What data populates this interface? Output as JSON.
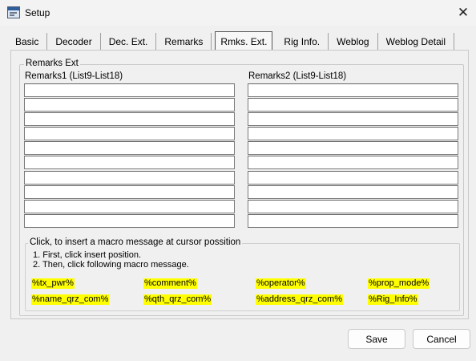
{
  "window": {
    "title": "Setup",
    "icon": "setup-app-icon"
  },
  "tabs": [
    {
      "label": "Basic"
    },
    {
      "label": "Decoder"
    },
    {
      "label": "Dec. Ext."
    },
    {
      "label": "Remarks"
    },
    {
      "label": "Rmks. Ext.",
      "active": true
    },
    {
      "label": "Rig Info."
    },
    {
      "label": "Weblog"
    },
    {
      "label": "Weblog Detail"
    }
  ],
  "remarks_ext": {
    "group_label": "Remarks Ext",
    "col1_label": "Remarks1 (List9-List18)",
    "col2_label": "Remarks2 (List9-List18)",
    "col1_values": [
      "",
      "",
      "",
      "",
      "",
      "",
      "",
      "",
      "",
      ""
    ],
    "col2_values": [
      "",
      "",
      "",
      "",
      "",
      "",
      "",
      "",
      "",
      ""
    ]
  },
  "macros": {
    "group_label": "Click, to insert a macro message at cursor possition",
    "instruction1": "1. First, click insert position.",
    "instruction2": "2. Then, click following macro message.",
    "items": [
      "%tx_pwr%",
      "%comment%",
      "%operator%",
      "%prop_mode%",
      "%name_qrz_com%",
      "%qth_qrz_com%",
      "%address_qrz_com%",
      "%Rig_Info%"
    ],
    "highlight_color": "#ffff00"
  },
  "buttons": {
    "save": "Save",
    "cancel": "Cancel"
  }
}
